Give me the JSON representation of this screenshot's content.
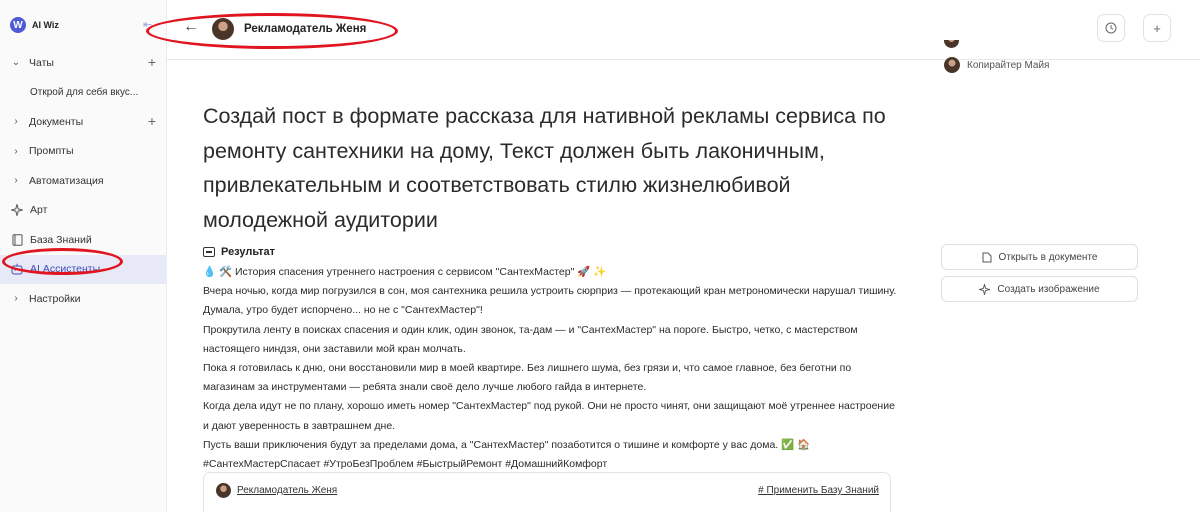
{
  "app": {
    "brand": "AI Wiz"
  },
  "sidebar": {
    "items": [
      {
        "label": "Чаты",
        "expandable": true,
        "has_add": true
      },
      {
        "label": "Открой для себя вкус..."
      },
      {
        "label": "Документы",
        "expandable": true,
        "has_add": true
      },
      {
        "label": "Промпты",
        "expandable": true
      },
      {
        "label": "Автоматизация",
        "expandable": true
      },
      {
        "label": "Арт",
        "icon": "sparkle-icon"
      },
      {
        "label": "База Знаний",
        "icon": "book-icon"
      },
      {
        "label": "AI Ассистенты",
        "icon": "robot-icon",
        "active": true
      },
      {
        "label": "Настройки",
        "expandable": true
      }
    ]
  },
  "header": {
    "title": "Рекламодатель Женя",
    "back_icon": "arrow-left-icon",
    "history_icon": "clock-icon",
    "add_icon": "plus-icon"
  },
  "participants": [
    {
      "name": "Копирайтер Майя"
    }
  ],
  "prompt": "Создай пост в формате рассказа для нативной рекламы сервиса по ремонту сантехники на дому, Текст должен быть лаконичным, привлекательным и соответствовать стилю жизнелюбивой молодежной аудитории",
  "result": {
    "label": "Результат",
    "lines": [
      "💧 🛠️ История спасения утреннего настроения с сервисом \"СантехМастер\" 🚀 ✨",
      "Вчера ночью, когда мир погрузился в сон, моя сантехника решила устроить сюрприз — протекающий кран метрономически нарушал тишину. Думала, утро будет испорчено... но не с \"СантехМастер\"!",
      "Прокрутила ленту в поисках спасения и один клик, один звонок, та-дам — и \"СантехМастер\" на пороге. Быстро, четко, с мастерством настоящего ниндзя, они заставили мой кран молчать.",
      "Пока я готовилась к дню, они восстановили мир в моей квартире. Без лишнего шума, без грязи и, что самое главное, без беготни по магазинам за инструментами — ребята знали своё дело лучше любого гайда в интернете.",
      "Когда дела идут не по плану, хорошо иметь номер \"СантехМастер\" под рукой. Они не просто чинят, они защищают моё утреннее настроение и дают уверенность в завтрашнем дне.",
      "Пусть ваши приключения будут за пределами дома, а \"СантехМастер\" позаботится о тишине и комфорте у вас дома. ✅ 🏠",
      "#СантехМастерСпасает #УтроБезПроблем #БыстрыйРемонт #ДомашнийКомфорт"
    ]
  },
  "actions": {
    "open_doc": "Открыть в документе",
    "create_image": "Создать изображение"
  },
  "composer": {
    "author": "Рекламодатель Женя",
    "kb_link": "# Применить Базу Знаний"
  },
  "colors": {
    "accent": "#4f5bd5",
    "highlight": "#e0151f"
  }
}
